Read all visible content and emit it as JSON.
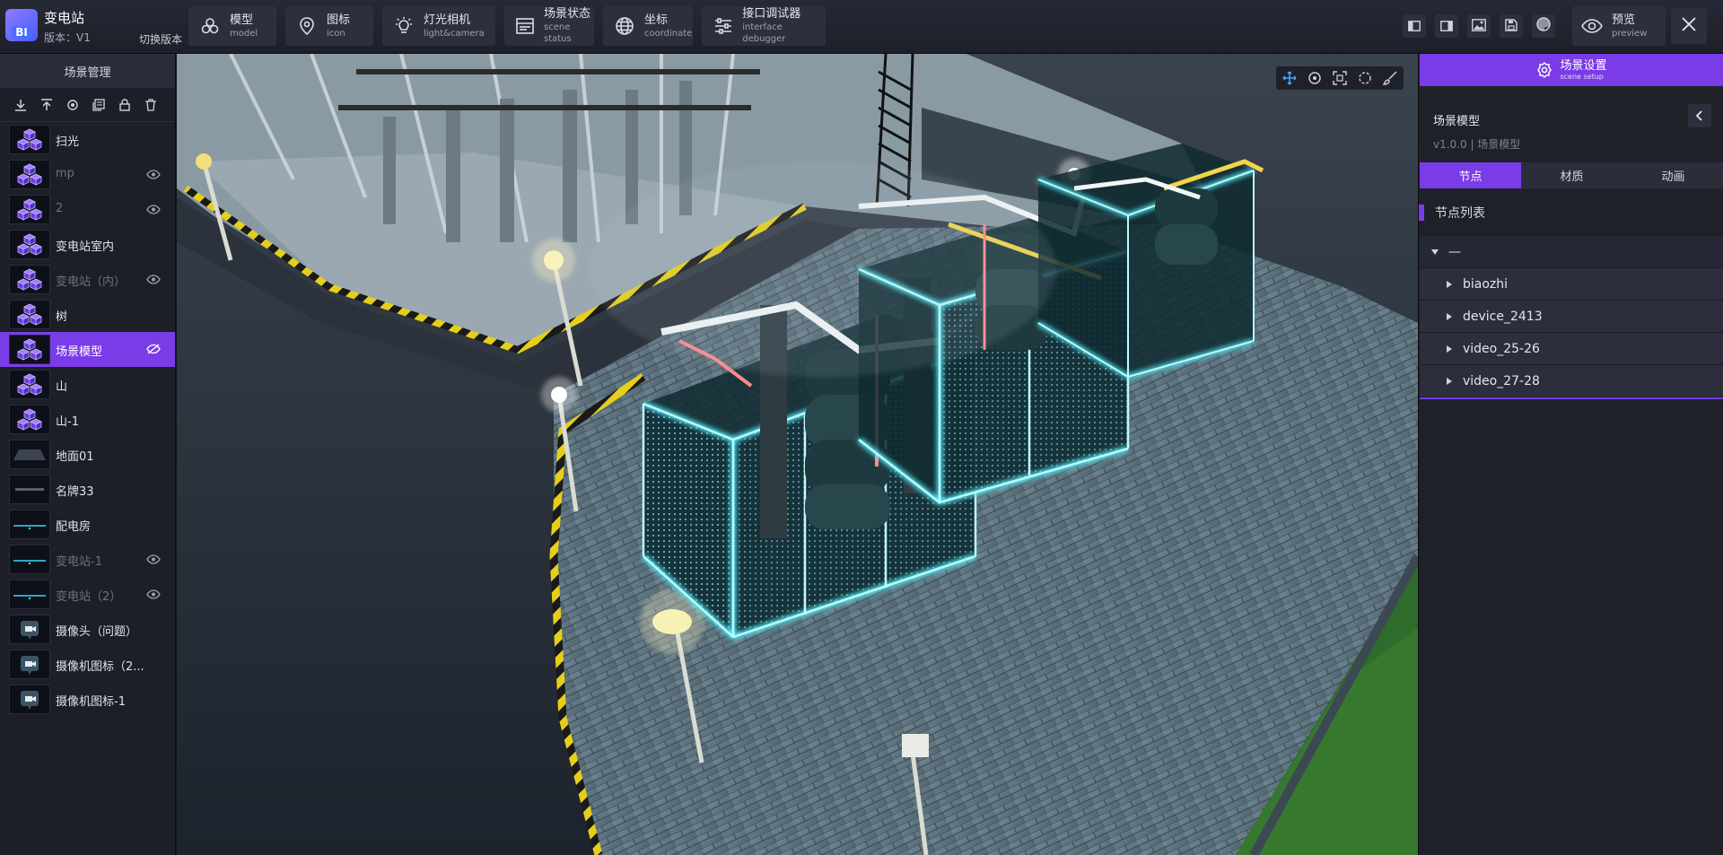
{
  "header": {
    "logo_text": "BI",
    "app_title": "变电站",
    "version": "版本：V1",
    "switch_version": "切换版本",
    "tools": [
      {
        "label": "模型",
        "sub": "model",
        "icon": "model-icon"
      },
      {
        "label": "图标",
        "sub": "icon",
        "icon": "location-pin-icon"
      },
      {
        "label": "灯光相机",
        "sub": "light&camera",
        "icon": "light-icon"
      },
      {
        "label": "场景状态",
        "sub": "scene status",
        "icon": "scene-status-icon"
      },
      {
        "label": "坐标",
        "sub": "coordinate",
        "icon": "globe-icon"
      },
      {
        "label": "接口调试器",
        "sub": "interface debugger",
        "icon": "sliders-icon"
      }
    ],
    "right_icons": [
      "layout-left-icon",
      "layout-right-icon",
      "image-icon",
      "save-icon",
      "palette-icon"
    ],
    "preview": {
      "label": "预览",
      "sub": "preview",
      "icon": "eye-icon"
    },
    "close_icon": "close-icon"
  },
  "left_panel": {
    "title": "场景管理",
    "toolbar_icons": [
      "import-icon",
      "export-icon",
      "locate-icon",
      "copy-icon",
      "lock-icon",
      "delete-icon"
    ],
    "items": [
      {
        "name": "扫光",
        "thumb": "cube",
        "dim": false,
        "eye": "",
        "selected": false
      },
      {
        "name": "mp",
        "thumb": "cube",
        "dim": true,
        "eye": "visible",
        "selected": false
      },
      {
        "name": "2",
        "thumb": "cube",
        "dim": true,
        "eye": "visible",
        "selected": false
      },
      {
        "name": "变电站室内",
        "thumb": "cube",
        "dim": false,
        "eye": "",
        "selected": false
      },
      {
        "name": "变电站（内）",
        "thumb": "cube",
        "dim": true,
        "eye": "visible",
        "selected": false
      },
      {
        "name": "树",
        "thumb": "cube",
        "dim": false,
        "eye": "",
        "selected": false
      },
      {
        "name": "场景模型",
        "thumb": "cube",
        "dim": false,
        "eye": "hidden",
        "selected": true
      },
      {
        "name": "山",
        "thumb": "cube",
        "dim": false,
        "eye": "",
        "selected": false
      },
      {
        "name": "山-1",
        "thumb": "cube",
        "dim": false,
        "eye": "",
        "selected": false
      },
      {
        "name": "地面01",
        "thumb": "ground",
        "dim": false,
        "eye": "",
        "selected": false
      },
      {
        "name": "名牌33",
        "thumb": "plate",
        "dim": false,
        "eye": "",
        "selected": false
      },
      {
        "name": "配电房",
        "thumb": "line",
        "dim": false,
        "eye": "",
        "selected": false
      },
      {
        "name": "变电站-1",
        "thumb": "line",
        "dim": true,
        "eye": "visible",
        "selected": false
      },
      {
        "name": "变电站（2）",
        "thumb": "line",
        "dim": true,
        "eye": "visible",
        "selected": false
      },
      {
        "name": "摄像头（问题）",
        "thumb": "camera",
        "dim": false,
        "eye": "",
        "selected": false
      },
      {
        "name": "摄像机图标（2...",
        "thumb": "camera",
        "dim": false,
        "eye": "",
        "selected": false
      },
      {
        "name": "摄像机图标-1",
        "thumb": "camera",
        "dim": false,
        "eye": "",
        "selected": false
      }
    ]
  },
  "viewport": {
    "tool_icons": [
      "move-icon",
      "target-icon",
      "scale-icon",
      "rotate-icon",
      "brush-icon"
    ]
  },
  "right_panel": {
    "settings_label": "场景设置",
    "settings_sub": "scene setup",
    "model_title": "场景模型",
    "model_sub": "v1.0.0 | 场景模型",
    "tabs": [
      {
        "label": "节点",
        "active": true
      },
      {
        "label": "材质",
        "active": false
      },
      {
        "label": "动画",
        "active": false
      }
    ],
    "node_list_title": "节点列表",
    "tree_root": "—",
    "tree_children": [
      "biaozhi",
      "device_2413",
      "video_25-26",
      "video_27-28"
    ]
  },
  "colors": {
    "accent": "#7a3ce6",
    "panel": "#1f2129",
    "topbar": "#262936",
    "glow": "#4ff4ff"
  }
}
